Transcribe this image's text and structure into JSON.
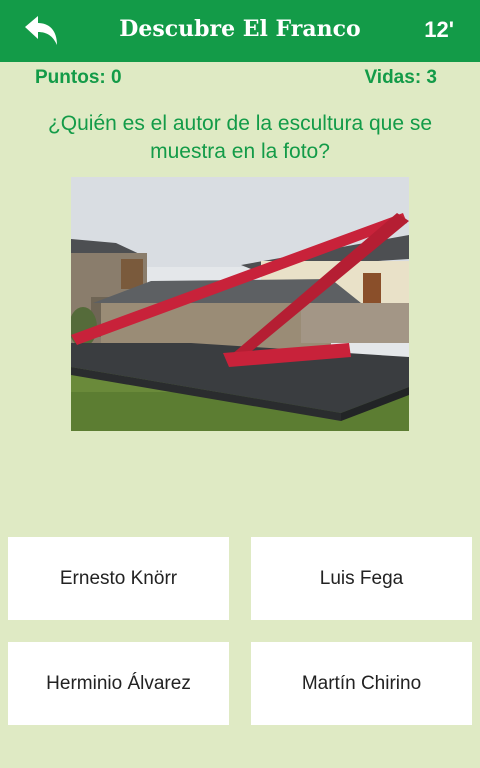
{
  "header": {
    "title": "Descubre El Franco",
    "timer": "12'",
    "back_icon": "back-arrow-icon"
  },
  "stats": {
    "points": "Puntos: 0",
    "lives": "Vidas: 3"
  },
  "question": {
    "text": "¿Quién es el autor de la escultura que se muestra en la foto?"
  },
  "answers": [
    {
      "label": "Ernesto Knörr"
    },
    {
      "label": "Luis Fega"
    },
    {
      "label": "Herminio Álvarez"
    },
    {
      "label": "Martín Chirino"
    }
  ],
  "colors": {
    "primary": "#139b48",
    "background": "#dfeac4",
    "card": "#ffffff"
  }
}
